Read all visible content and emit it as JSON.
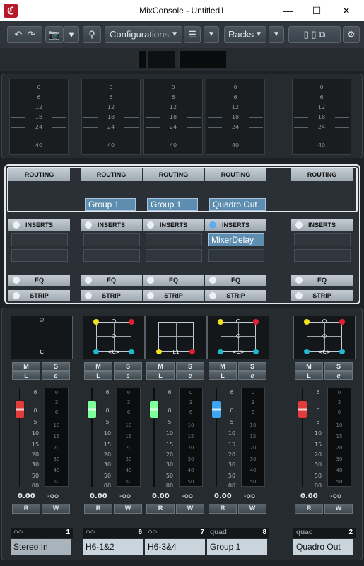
{
  "window": {
    "title": "MixConsole - Untitled1",
    "app_icon": "cubase-icon"
  },
  "toolbar": {
    "configurations_label": "Configurations",
    "racks_label": "Racks"
  },
  "meter_scale": [
    "0",
    "6",
    "12",
    "18",
    "24",
    "40"
  ],
  "rack": {
    "routing_label": "ROUTING",
    "inserts_label": "INSERTS",
    "eq_label": "EQ",
    "strip_label": "STRIP"
  },
  "fader_scale": [
    "6",
    "0",
    "5",
    "10",
    "15",
    "20",
    "30",
    "50",
    "00"
  ],
  "meter_scale_db": [
    "0",
    "3",
    "6",
    "10",
    "15",
    "20",
    "30",
    "40",
    "50"
  ],
  "buttons": {
    "m": "M",
    "s": "S",
    "l": "L",
    "e": "e",
    "r": "R",
    "w": "W"
  },
  "channels": [
    {
      "name": "Stereo In",
      "number": "1",
      "routing": "",
      "insert": "",
      "volume": "0.00",
      "peak": "-oo",
      "pan_label": "C",
      "type_icon": "stereo-icon",
      "fader_color": "#e23b3b"
    },
    {
      "name": "H6-1&2",
      "number": "6",
      "routing": "Group 1",
      "insert": "",
      "volume": "0.00",
      "peak": "-oo",
      "pan_label": "<C>",
      "type_icon": "stereo-icon",
      "fader_color": "#7dff9a"
    },
    {
      "name": "H6-3&4",
      "number": "7",
      "routing": "Group 1",
      "insert": "",
      "volume": "0.00",
      "peak": "-oo",
      "pan_label": "L1",
      "type_icon": "stereo-icon",
      "fader_color": "#7dff9a"
    },
    {
      "name": "Group 1",
      "number": "8",
      "routing": "Quadro Out",
      "insert": "MixerDelay",
      "volume": "0.00",
      "peak": "-oo",
      "pan_label": "<C>",
      "type_icon": "quad",
      "fader_color": "#3da5f0"
    },
    {
      "name": "Quadro Out",
      "number": "2",
      "routing": "",
      "insert": "",
      "volume": "0.00",
      "peak": "-oo",
      "pan_label": "<C>",
      "type_icon": "quac",
      "fader_color": "#e23b3b"
    }
  ]
}
